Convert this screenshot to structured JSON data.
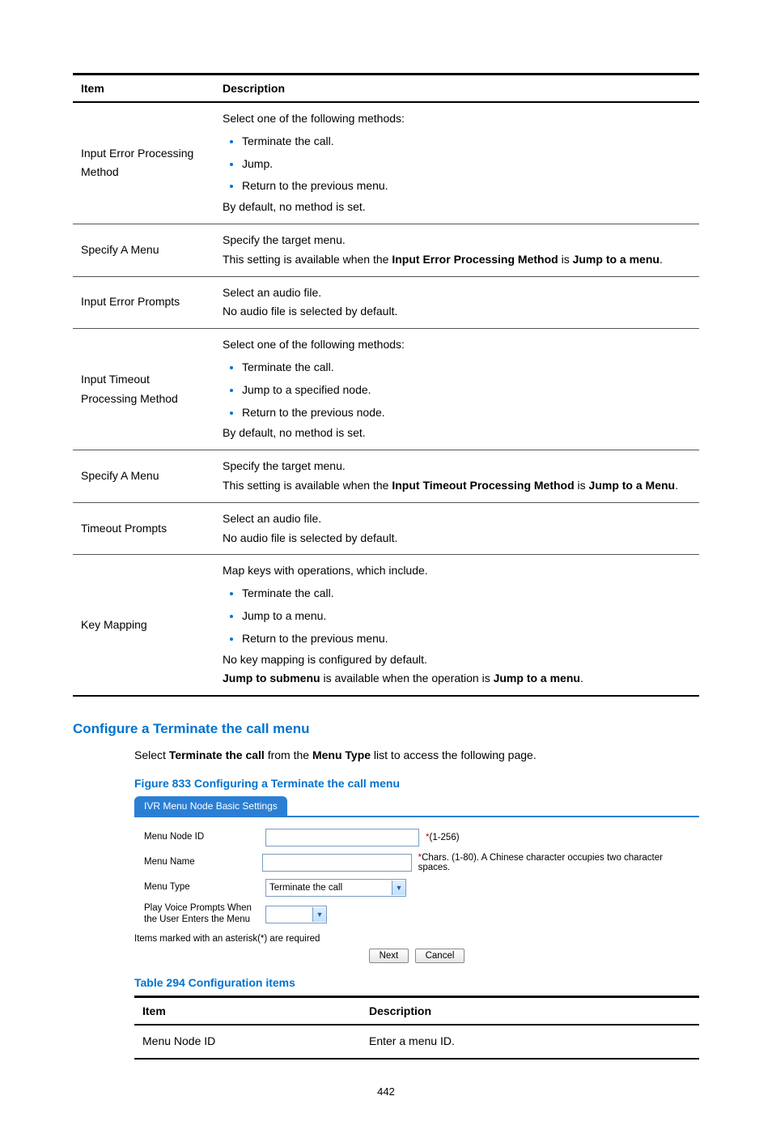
{
  "table1": {
    "headers": [
      "Item",
      "Description"
    ],
    "rows": [
      {
        "item": "Input Error Processing Method",
        "desc_intro": "Select one of the following methods:",
        "bullets": [
          "Terminate the call.",
          "Jump.",
          "Return to the previous menu."
        ],
        "desc_outro": "By default, no method is set."
      },
      {
        "item": "Specify A Menu",
        "line1": "Specify the target menu.",
        "line2_a": "This setting is available when the ",
        "line2_b": "Input Error Processing Method",
        "line2_c": " is ",
        "line2_d": "Jump to a menu",
        "line2_e": "."
      },
      {
        "item": "Input Error Prompts",
        "line1": "Select an audio file.",
        "line2": "No audio file is selected by default."
      },
      {
        "item": "Input Timeout Processing Method",
        "desc_intro": "Select one of the following methods:",
        "bullets": [
          "Terminate the call.",
          "Jump to a specified node.",
          "Return to the previous node."
        ],
        "desc_outro": "By default, no method is set."
      },
      {
        "item": "Specify A Menu",
        "line1": "Specify the target menu.",
        "line2_a": "This setting is available when the ",
        "line2_b": "Input Timeout Processing Method",
        "line2_c": " is ",
        "line2_d": "Jump to a Menu",
        "line2_e": "."
      },
      {
        "item": "Timeout Prompts",
        "line1": "Select an audio file.",
        "line2": "No audio file is selected by default."
      },
      {
        "item": "Key Mapping",
        "desc_intro": "Map keys with operations, which include.",
        "bullets": [
          "Terminate the call.",
          "Jump to a menu.",
          "Return to the previous menu."
        ],
        "desc_outro": "No key mapping is configured by default.",
        "extra_a": "Jump to submenu",
        "extra_b": " is available when the operation is ",
        "extra_c": "Jump to a menu",
        "extra_d": "."
      }
    ]
  },
  "section_heading": "Configure a Terminate the call menu",
  "body_text": {
    "a": "Select ",
    "b": "Terminate the call",
    "c": " from the ",
    "d": "Menu Type",
    "e": " list to access the following page."
  },
  "figure_caption": "Figure 833 Configuring a Terminate the call menu",
  "figure": {
    "tab": "IVR Menu Node Basic Settings",
    "rows": {
      "menu_node_id_label": "Menu Node ID",
      "menu_node_id_hint": "(1-256)",
      "menu_name_label": "Menu Name",
      "menu_name_hint": "Chars. (1-80). A Chinese character occupies two character spaces.",
      "menu_type_label": "Menu Type",
      "menu_type_value": "Terminate the call",
      "play_prompts_label": "Play Voice Prompts When the User Enters the Menu"
    },
    "footnote": "Items marked with an asterisk(*) are required",
    "buttons": {
      "next": "Next",
      "cancel": "Cancel"
    }
  },
  "table2_caption": "Table 294 Configuration items",
  "table2": {
    "headers": [
      "Item",
      "Description"
    ],
    "rows": [
      {
        "item": "Menu Node ID",
        "desc": "Enter a menu ID."
      }
    ]
  },
  "page_number": "442"
}
